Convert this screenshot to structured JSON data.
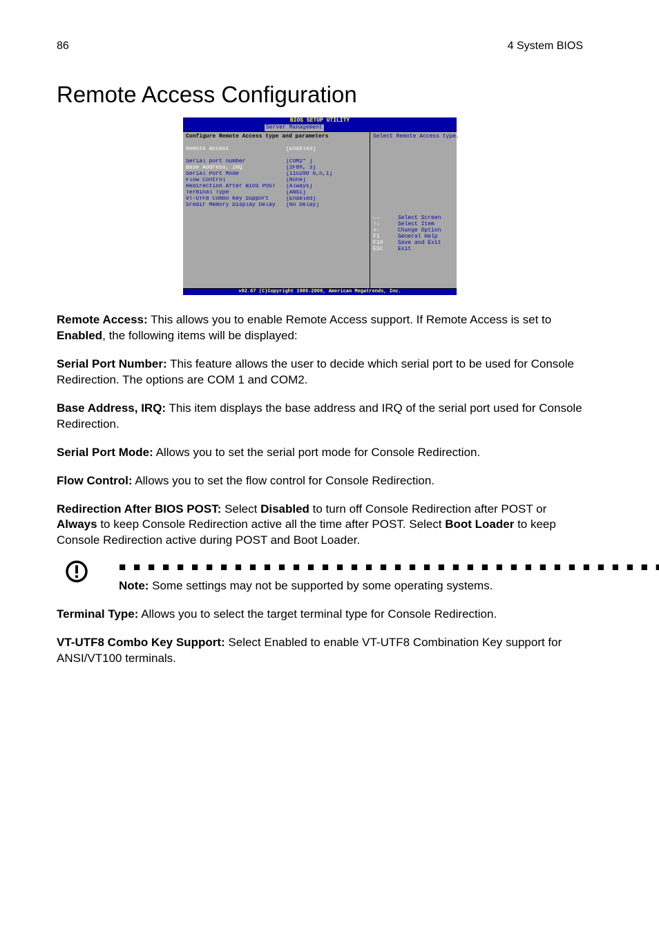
{
  "header": {
    "page_number": "86",
    "section_title": "4 System BIOS"
  },
  "title": "Remote Access Configuration",
  "bios": {
    "title": "BIOS SETUP UTILITY",
    "tab": "Server Management",
    "head": "Configure Remote Access type and parameters",
    "remote_access_label": "Remote Access",
    "remote_access_value": "[Enabled]",
    "rows": [
      {
        "lbl": "Serial port number",
        "val": "[COM2* ]"
      },
      {
        "lbl": "    Base Address, IRQ",
        "val": "[2F8h, 3]"
      },
      {
        "lbl": "Serial Port Mode",
        "val": "[115200 8,n,1]"
      },
      {
        "lbl": "Flow Control",
        "val": "[None]"
      },
      {
        "lbl": "Redirection After BIOS POST",
        "val": "[Always]"
      },
      {
        "lbl": "Terminal Type",
        "val": "[ANSI]"
      },
      {
        "lbl": "VT-UTF8 Combo Key Support",
        "val": "[Enabled]"
      },
      {
        "lbl": "Sredir Memory Display Delay",
        "val": "[No Delay]"
      }
    ],
    "help_top": "Select Remote Access type.",
    "keys": [
      {
        "k": "←→",
        "d": "Select Screen"
      },
      {
        "k": "↑↓",
        "d": "Select Item"
      },
      {
        "k": "+-",
        "d": "Change Option"
      },
      {
        "k": "F1",
        "d": "General Help"
      },
      {
        "k": "F10",
        "d": "Save and Exit"
      },
      {
        "k": "ESC",
        "d": "Exit"
      }
    ],
    "footer": "v02.67 (C)Copyright 1985-2009, American Megatrends, Inc."
  },
  "paras": {
    "p1a": "Remote Access:",
    "p1b": " This allows you to enable Remote Access support. If Remote Access is set to ",
    "p1c": "Enabled",
    "p1d": ", the following items will be displayed:",
    "p2a": "Serial Port Number:",
    "p2b": " This feature allows the user to decide which serial port to be used for Console Redirection. The options are COM 1 and COM2.",
    "p3a": "Base Address, IRQ:",
    "p3b": " This item displays the base address and IRQ of the serial port used for Console Redirection.",
    "p4a": "Serial Port Mode:",
    "p4b": " Allows you to set the serial port mode for Console Redirection.",
    "p5a": "Flow Control:",
    "p5b": " Allows you to set the flow control for Console Redirection.",
    "p6a": "Redirection After BIOS POST:",
    "p6b": " Select ",
    "p6c": "Disabled",
    "p6d": " to turn off Console Redirection after POST or ",
    "p6e": "Always",
    "p6f": " to keep Console Redirection active all the time after POST. Select ",
    "p6g": "Boot Loader",
    "p6h": " to keep Console Redirection active during POST and Boot Loader.",
    "note_dots": "■ ■ ■ ■ ■ ■ ■ ■ ■ ■ ■ ■ ■ ■ ■ ■ ■ ■ ■ ■ ■ ■ ■ ■ ■ ■ ■ ■ ■ ■ ■ ■ ■ ■ ■ ■ ■ ■ ■ ■ ■ ■ ■ ■ ■ ■ ■ ■",
    "note_a": "Note:",
    "note_b": " Some settings may not be supported by some operating systems.",
    "p7a": "Terminal Type:",
    "p7b": " Allows you to select the target terminal type for Console Redirection.",
    "p8a": "VT-UTF8 Combo Key Support:",
    "p8b": " Select Enabled to enable VT-UTF8 Combination Key support for ANSI/VT100 terminals."
  }
}
